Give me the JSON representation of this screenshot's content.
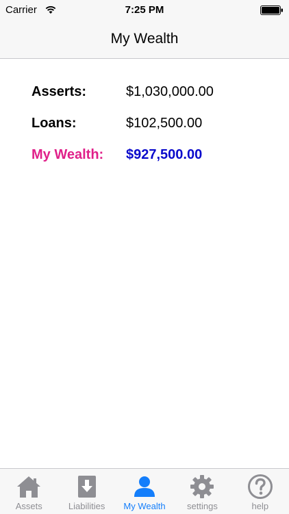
{
  "status_bar": {
    "carrier": "Carrier",
    "time": "7:25 PM",
    "icons": [
      "wifi-icon",
      "battery-icon"
    ]
  },
  "nav": {
    "title": "My Wealth"
  },
  "summary": {
    "assets": {
      "label": "Asserts:",
      "value": "$1,030,000.00"
    },
    "loans": {
      "label": "Loans:",
      "value": "$102,500.00"
    },
    "wealth": {
      "label": "My Wealth:",
      "value": "$927,500.00"
    }
  },
  "colors": {
    "wealth_label": "#e0218a",
    "wealth_value": "#0a0acc",
    "tab_active": "#147efb",
    "tab_inactive": "#8e8e93"
  },
  "tabs": [
    {
      "label": "Assets",
      "icon": "house-icon",
      "active": false
    },
    {
      "label": "Liabilities",
      "icon": "download-icon",
      "active": false
    },
    {
      "label": "My Wealth",
      "icon": "person-icon",
      "active": true
    },
    {
      "label": "settings",
      "icon": "gear-icon",
      "active": false
    },
    {
      "label": "help",
      "icon": "question-icon",
      "active": false
    }
  ]
}
